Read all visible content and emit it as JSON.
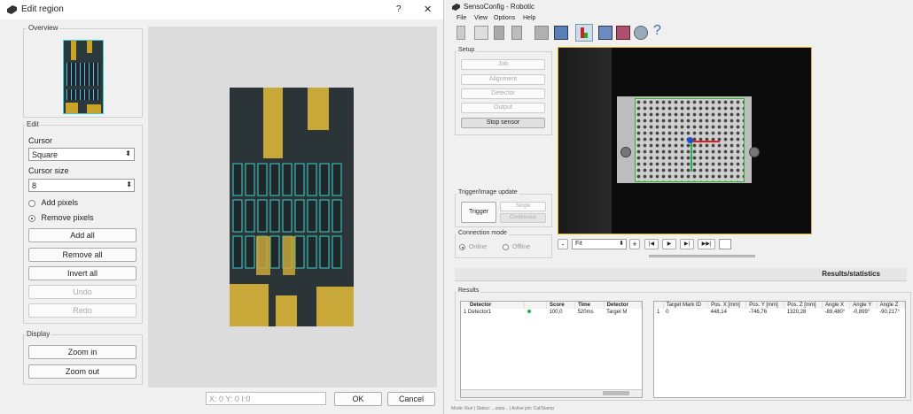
{
  "edit_region": {
    "title": "Edit region",
    "help": "?",
    "close": "✕",
    "overview_label": "Overview",
    "edit_label": "Edit",
    "cursor_label": "Cursor",
    "cursor_value": "Square",
    "cursor_size_label": "Cursor size",
    "cursor_size_value": "8",
    "add_pixels": "Add pixels",
    "remove_pixels": "Remove pixels",
    "add_all": "Add all",
    "remove_all": "Remove all",
    "invert_all": "Invert all",
    "undo": "Undo",
    "redo": "Redo",
    "display_label": "Display",
    "zoom_in": "Zoom in",
    "zoom_out": "Zoom out",
    "coords": "X: 0 Y: 0 I:0",
    "ok": "OK",
    "cancel": "Cancel"
  },
  "senso": {
    "title": "SensoConfig - Robotic",
    "menu": [
      "File",
      "View",
      "Options",
      "Help"
    ],
    "setup_label": "Setup",
    "setup_buttons": [
      "Job",
      "Alignment",
      "Detector",
      "Output",
      "Stop sensor"
    ],
    "trigger_label": "Trigger/Image update",
    "trigger": "Trigger",
    "single": "Single",
    "continuous": "Continuous",
    "connection_label": "Connection mode",
    "online": "Online",
    "offline": "Offline",
    "zoom_minus": "-",
    "zoom_value": "Fit",
    "zoom_plus": "+",
    "player_buttons": [
      "|◀",
      "▶",
      "▶|",
      "▶▶|"
    ],
    "results_statistics": "Results/statistics",
    "results_label": "Results",
    "left_table": {
      "headers": [
        "Detector",
        "Score",
        "Time",
        "Detector"
      ],
      "rows": [
        [
          "1",
          "Detector1",
          "100,0",
          "520ms",
          "Target M"
        ]
      ]
    },
    "right_table": {
      "headers": [
        "",
        "Target Mark ID",
        "Pos. X [mm]",
        "Pos. Y [mm]",
        "Pos. Z [mm]",
        "Angle X",
        "Angle Y",
        "Angle Z"
      ],
      "rows": [
        [
          "1",
          "0",
          "448,14",
          "-746,76",
          "1320,28",
          "-89,480°",
          "-0,899°",
          "-90,217°"
        ]
      ]
    },
    "status": "Mode: Run  |  Status: ...stats...  |  Active job: Cal/Stamp"
  },
  "colors": {
    "accent_yellow": "#f1c232",
    "status_green": "#22b14c",
    "mark_blue": "#1f4fd0",
    "mark_red": "#e02020"
  }
}
